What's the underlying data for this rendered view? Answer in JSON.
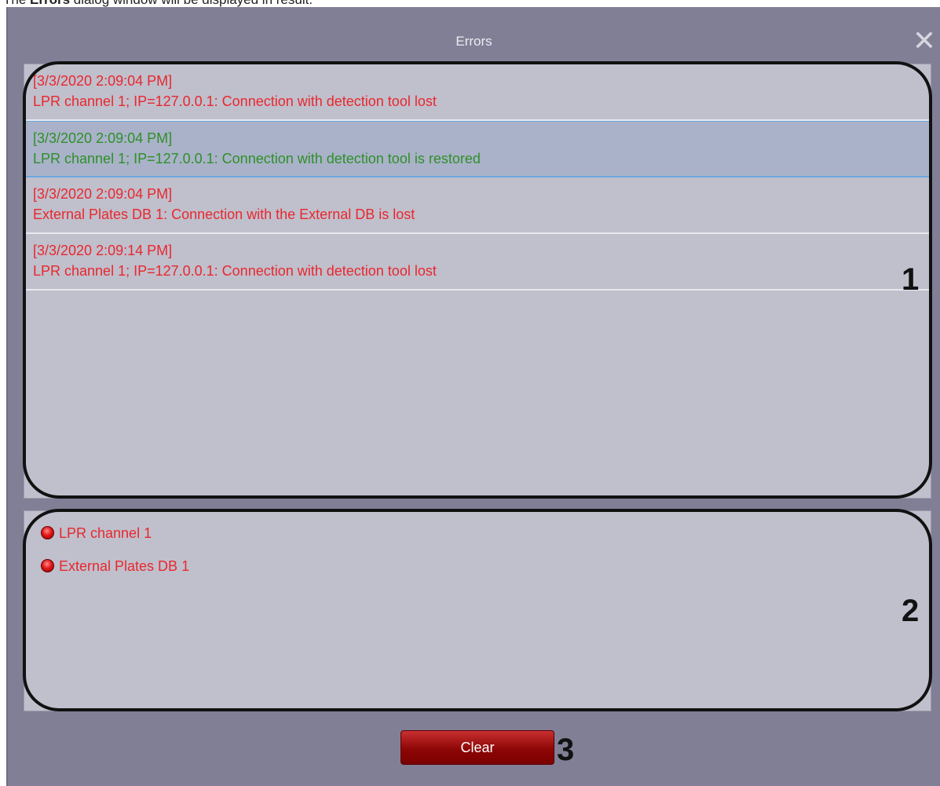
{
  "caption": {
    "prefix": "The ",
    "bold": "Errors",
    "suffix": " dialog window will be displayed in result."
  },
  "dialog": {
    "title": "Errors",
    "close_glyph": "✕"
  },
  "log": {
    "entries": [
      {
        "timestamp": "[3/3/2020 2:09:04 PM]",
        "message": "LPR channel  1; IP=127.0.0.1: Connection with detection tool lost",
        "color": "#e8282e"
      },
      {
        "timestamp": "[3/3/2020 2:09:04 PM]",
        "message": "LPR channel  1; IP=127.0.0.1: Connection with detection tool is restored",
        "color": "#2f8f2a"
      },
      {
        "timestamp": "[3/3/2020 2:09:04 PM]",
        "message": "External Plates DB 1: Connection with the External DB is lost",
        "color": "#e8282e"
      },
      {
        "timestamp": "[3/3/2020 2:09:14 PM]",
        "message": "LPR channel  1; IP=127.0.0.1: Connection with detection tool lost",
        "color": "#e8282e"
      }
    ]
  },
  "status": {
    "items": [
      {
        "label": "LPR channel  1",
        "icon": "red-status-led-icon"
      },
      {
        "label": "External Plates DB 1",
        "icon": "red-status-led-icon"
      }
    ]
  },
  "buttons": {
    "clear_label": "Clear"
  },
  "callouts": {
    "marker_1": "1",
    "marker_2": "2",
    "marker_3": "3"
  },
  "colors": {
    "window_bg": "#807f95",
    "panel_bg": "#c0bfcc",
    "error_red": "#e8282e",
    "ok_green": "#2f8f2a",
    "selection_bg": "#a9b2c8",
    "button_red": "#8e0606"
  }
}
